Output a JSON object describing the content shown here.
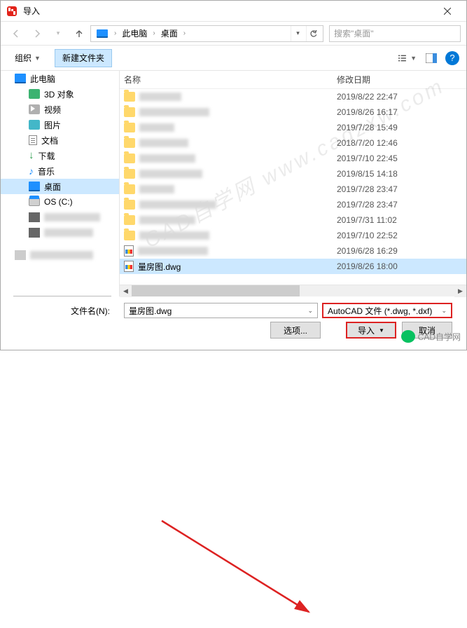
{
  "window": {
    "title": "导入"
  },
  "nav": {
    "breadcrumb": {
      "root": "此电脑",
      "loc": "桌面"
    },
    "search_placeholder": "搜索\"桌面\""
  },
  "toolbar": {
    "organize": "组织",
    "new_folder": "新建文件夹"
  },
  "sidebar": {
    "this_pc": "此电脑",
    "objects3d": "3D 对象",
    "videos": "视频",
    "pictures": "图片",
    "documents": "文档",
    "downloads": "下载",
    "music": "音乐",
    "desktop": "桌面",
    "osc": "OS (C:)"
  },
  "file_header": {
    "name": "名称",
    "date": "修改日期"
  },
  "files": [
    {
      "name": "",
      "obsc": true,
      "date": "2019/8/22 22:47",
      "kind": "folder"
    },
    {
      "name": "",
      "obsc": true,
      "date": "2019/8/26 16:17",
      "kind": "folder"
    },
    {
      "name": "",
      "obsc": true,
      "date": "2019/7/28 15:49",
      "kind": "folder"
    },
    {
      "name": "",
      "obsc": true,
      "date": "2018/7/20 12:46",
      "kind": "folder"
    },
    {
      "name": "",
      "obsc": true,
      "date": "2019/7/10 22:45",
      "kind": "folder"
    },
    {
      "name": "",
      "obsc": true,
      "date": "2019/8/15 14:18",
      "kind": "folder"
    },
    {
      "name": "",
      "obsc": true,
      "date": "2019/7/28 23:47",
      "kind": "folder"
    },
    {
      "name": "",
      "obsc": true,
      "date": "2019/7/28 23:47",
      "kind": "folder"
    },
    {
      "name": "",
      "obsc": true,
      "date": "2019/7/31 11:02",
      "kind": "folder"
    },
    {
      "name": "",
      "obsc": true,
      "date": "2019/7/10 22:52",
      "kind": "folder"
    },
    {
      "name": "vg",
      "obsc": true,
      "date": "2019/6/28 16:29",
      "kind": "dwg"
    },
    {
      "name": "量房图.dwg",
      "obsc": false,
      "date": "2019/8/26 18:00",
      "kind": "dwg",
      "selected": true
    }
  ],
  "bottom": {
    "filename_label": "文件名(N):",
    "filename_value": "量房图.dwg",
    "filetype_value": "AutoCAD 文件 (*.dwg, *.dxf)",
    "options_btn": "选项...",
    "import_btn": "导入",
    "cancel_btn": "取消"
  },
  "overlay": {
    "wechat_label": "CAD自学网",
    "watermark": "CAD自学网  www.cadzxw.com"
  }
}
